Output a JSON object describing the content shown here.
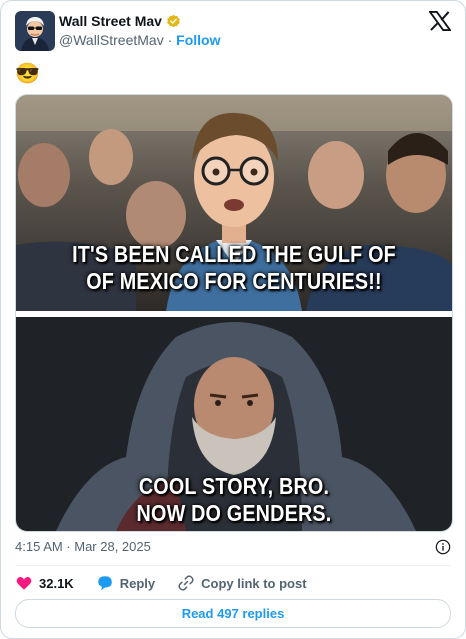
{
  "author": {
    "display_name": "Wall Street Mav",
    "handle": "@WallStreetMav",
    "separator": "·",
    "follow_label": "Follow"
  },
  "post": {
    "text": "😎",
    "meme_top_caption": [
      "IT'S BEEN CALLED THE GULF OF",
      "OF MEXICO FOR CENTURIES!!"
    ],
    "meme_bottom_caption": [
      "COOL STORY, BRO.",
      "NOW DO GENDERS."
    ],
    "timestamp": "4:15 AM · Mar 28, 2025"
  },
  "actions": {
    "likes": "32.1K",
    "reply_label": "Reply",
    "copy_link_label": "Copy link to post"
  },
  "footer": {
    "read_replies_label": "Read 497 replies"
  },
  "colors": {
    "accent": "#1d9bf0",
    "like": "#f91880",
    "verified_badge": "#e2b719",
    "secondary_text": "#536471"
  },
  "icons": [
    "avatar",
    "verified-badge-icon",
    "x-logo-icon",
    "info-icon",
    "heart-icon",
    "reply-bubble-icon",
    "link-icon"
  ]
}
